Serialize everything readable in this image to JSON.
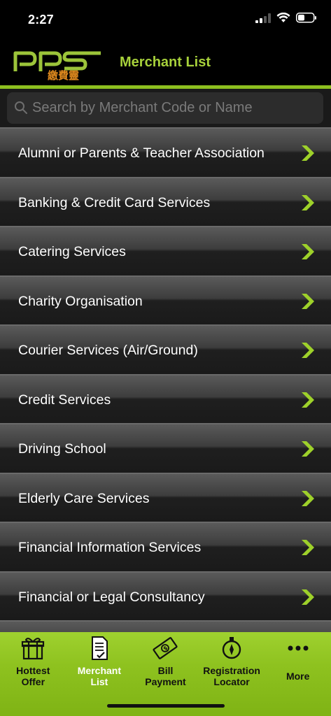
{
  "status": {
    "time": "2:27"
  },
  "header": {
    "title": "Merchant List",
    "logo_text": "pps",
    "logo_subtext": "繳費靈"
  },
  "search": {
    "placeholder": "Search by Merchant Code or Name"
  },
  "colors": {
    "accent": "#a7d13b",
    "tab_bar": "#8ec21f",
    "background": "#000000"
  },
  "list": {
    "items": [
      {
        "label": "Alumni or Parents & Teacher Association"
      },
      {
        "label": "Banking & Credit Card Services"
      },
      {
        "label": "Catering Services"
      },
      {
        "label": "Charity Organisation"
      },
      {
        "label": "Courier Services (Air/Ground)"
      },
      {
        "label": "Credit Services"
      },
      {
        "label": "Driving School"
      },
      {
        "label": "Elderly Care Services"
      },
      {
        "label": "Financial Information Services"
      },
      {
        "label": "Financial or Legal Consultancy"
      }
    ]
  },
  "tabs": [
    {
      "label": "Hottest\nOffer",
      "icon": "gift-icon"
    },
    {
      "label": "Merchant\nList",
      "icon": "document-check-icon",
      "active": true
    },
    {
      "label": "Bill\nPayment",
      "icon": "bill-icon"
    },
    {
      "label": "Registration\nLocator",
      "icon": "compass-icon"
    },
    {
      "label": "More",
      "icon": "more-icon"
    }
  ]
}
